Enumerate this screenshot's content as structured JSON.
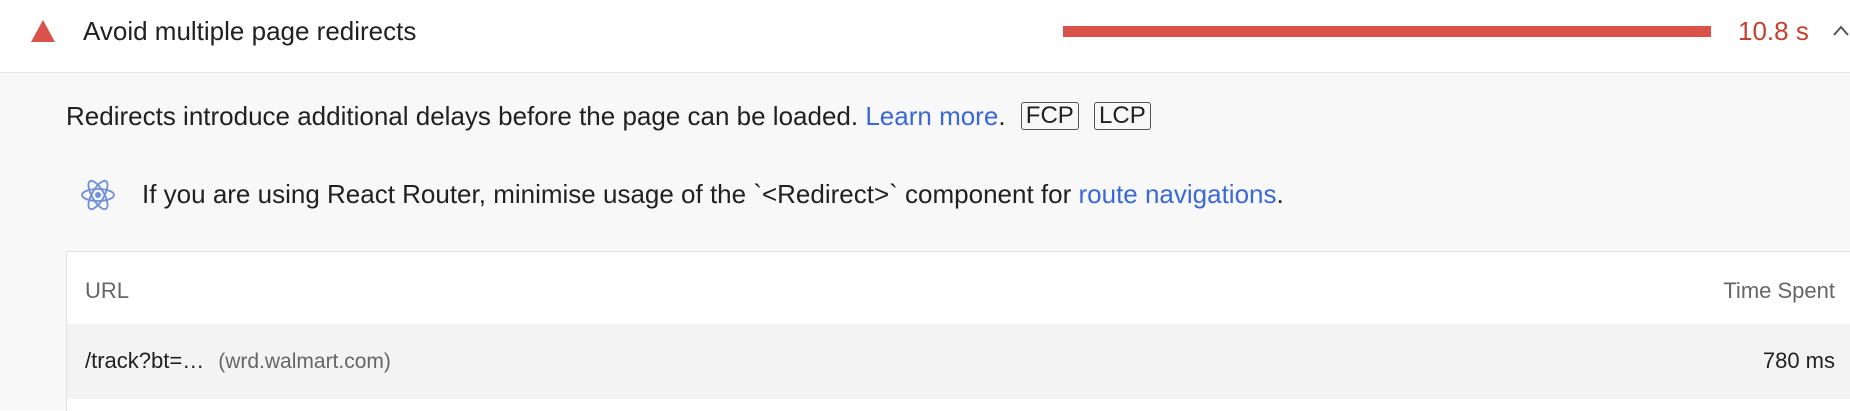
{
  "audit": {
    "title": "Avoid multiple page redirects",
    "metric_value": "10.8 s",
    "metric_fraction": 1.0,
    "status_color": "#d9534a",
    "status_icon": "warning-triangle-icon",
    "expand_icon": "chevron-up-icon"
  },
  "description": {
    "text": "Redirects introduce additional delays before the page can be loaded.",
    "link_text": "Learn more",
    "suffix": ".",
    "tags": [
      "FCP",
      "LCP"
    ]
  },
  "stack_tip": {
    "icon": "react-icon",
    "text": "If you are using React Router, minimise usage of the `<Redirect>` component for",
    "link_text": "route navigations",
    "suffix": "."
  },
  "table": {
    "headers": {
      "url": "URL",
      "time": "Time Spent"
    },
    "rows": [
      {
        "url": "/track?bt=…",
        "host": "(wrd.walmart.com)",
        "time": "780 ms"
      }
    ]
  }
}
